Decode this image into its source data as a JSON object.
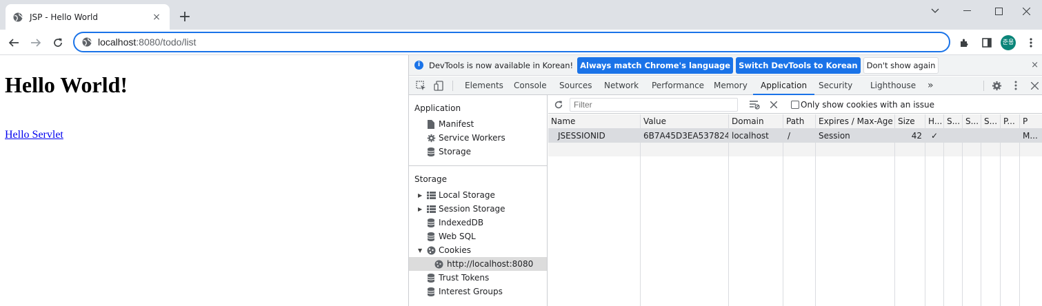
{
  "browser": {
    "tab_title": "JSP - Hello World",
    "tab_close": "×",
    "new_tab": "+",
    "url_host": "localhost",
    "url_rest": ":8080/todo/list",
    "profile_initials": "준용",
    "accent_color": "#1a73e8"
  },
  "page": {
    "heading": "Hello World!",
    "link": "Hello Servlet"
  },
  "devtools": {
    "infobar": {
      "message": "DevTools is now available in Korean!",
      "btn_match": "Always match Chrome's language",
      "btn_switch": "Switch DevTools to Korean",
      "btn_dismiss": "Don't show again",
      "close": "×"
    },
    "tabs": {
      "elements": "Elements",
      "console": "Console",
      "sources": "Sources",
      "network": "Network",
      "performance": "Performance",
      "memory": "Memory",
      "application": "Application",
      "security": "Security",
      "lighthouse": "Lighthouse",
      "more": "»"
    },
    "sidebar": {
      "application_header": "Application",
      "manifest": "Manifest",
      "service_workers": "Service Workers",
      "storage_item": "Storage",
      "storage_header": "Storage",
      "local_storage": "Local Storage",
      "session_storage": "Session Storage",
      "indexeddb": "IndexedDB",
      "web_sql": "Web SQL",
      "cookies": "Cookies",
      "cookie_origin": "http://localhost:8080",
      "trust_tokens": "Trust Tokens",
      "interest_groups": "Interest Groups"
    },
    "cookies": {
      "filter_placeholder": "Filter",
      "only_issue_label": "Only show cookies with an issue",
      "columns": {
        "name": "Name",
        "value": "Value",
        "domain": "Domain",
        "path": "Path",
        "expires": "Expires / Max-Age",
        "size": "Size",
        "httponly": "H...",
        "secure": "S...",
        "samesite": "S...",
        "sameparty": "S...",
        "partition": "P...",
        "priority": "P"
      },
      "row": {
        "name": "JSESSIONID",
        "value": "6B7A45D3EA537824...",
        "domain": "localhost",
        "path": "/",
        "expires": "Session",
        "size": "42",
        "httponly": "✓",
        "priority": "M..."
      }
    }
  }
}
